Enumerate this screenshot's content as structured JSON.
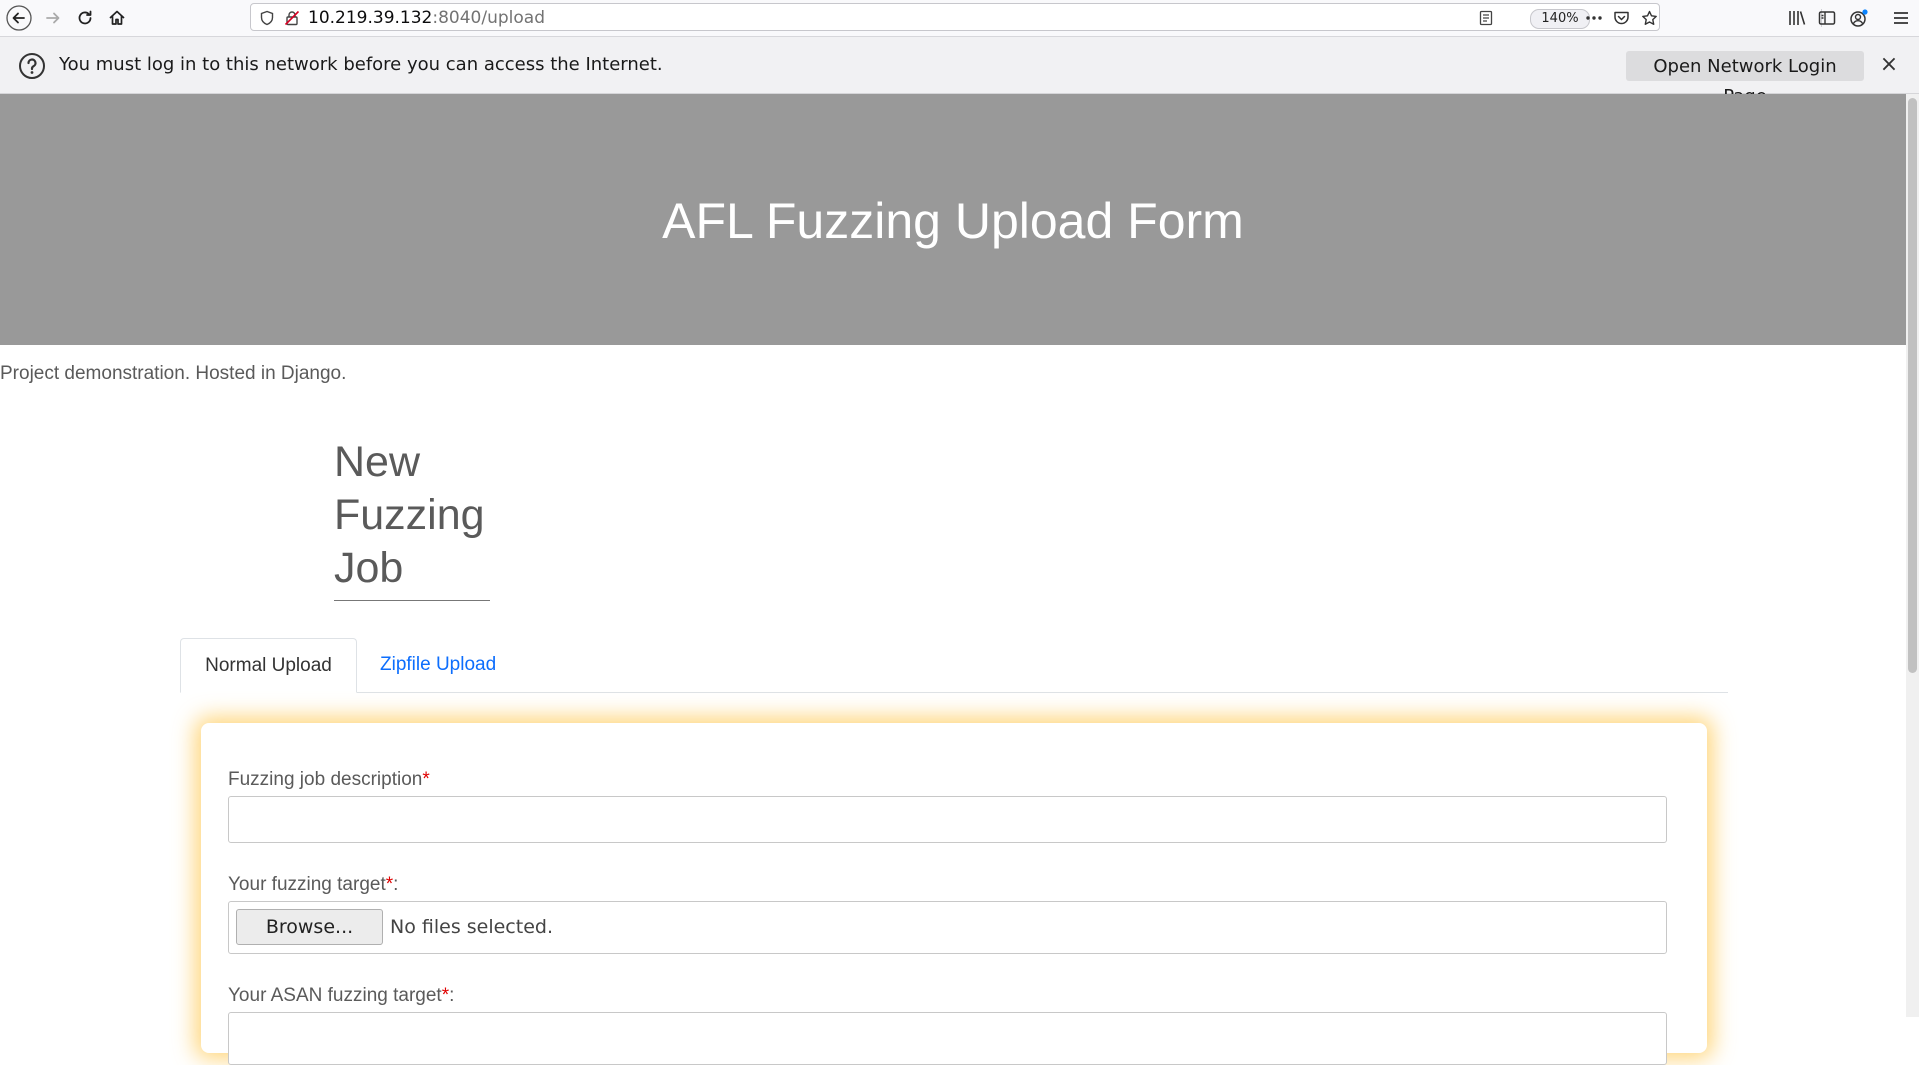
{
  "browser": {
    "url_host": "10.219.39.132",
    "url_path": ":8040/upload",
    "zoom": "140%",
    "icons": [
      "back-icon",
      "forward-icon",
      "reload-icon",
      "home-icon",
      "tracking-shield-icon",
      "insecure-lock-icon",
      "reader-view-icon",
      "page-actions-icon",
      "pocket-icon",
      "bookmark-star-icon",
      "library-icon",
      "sidebar-icon",
      "account-icon",
      "menu-icon"
    ]
  },
  "notice": {
    "text": "You must log in to this network before you can access the Internet.",
    "button_label": "Open Network Login Page",
    "close_label": "×"
  },
  "page": {
    "hero_title": "AFL Fuzzing Upload Form",
    "tagline": "Project demonstration. Hosted in Django.",
    "heading": "New Fuzzing Job",
    "tabs": [
      {
        "label": "Normal Upload",
        "active": true
      },
      {
        "label": "Zipfile Upload",
        "active": false
      }
    ],
    "form": {
      "description_label": "Fuzzing job description",
      "description_value": "",
      "required_mark": "*",
      "target_label": "Your fuzzing target",
      "asan_label": "Your ASAN fuzzing target",
      "label_suffix": ":",
      "browse_label": "Browse...",
      "no_file_text": "No files selected."
    }
  },
  "colors": {
    "hero_bg": "#999999",
    "link": "#0d6efd",
    "required": "#e00000",
    "card_glow": "#ffc850"
  }
}
